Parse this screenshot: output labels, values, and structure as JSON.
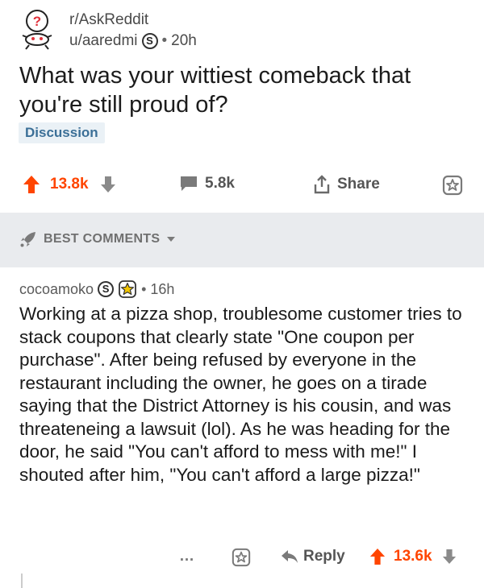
{
  "post": {
    "subreddit": "r/AskReddit",
    "author": "u/aaredmi",
    "time": "20h",
    "title": "What was your wittiest comeback that you're still proud of?",
    "flair": "Discussion"
  },
  "actions": {
    "score": "13.8k",
    "comments": "5.8k",
    "share": "Share"
  },
  "sort": {
    "label": "BEST COMMENTS"
  },
  "comment": {
    "author": "cocoamoko",
    "time": "16h",
    "body": "Working at a pizza shop, troublesome customer tries to stack coupons that clearly state \"One coupon per purchase\". After being refused by everyone in the restaurant including the owner, he goes on a tirade saying that the District Attorney is his cousin, and  was threateneing a lawsuit (lol). As he was heading for the door, he said \"You can't afford to mess with me!\" I shouted after him, \"You can't afford a large pizza!\"",
    "more": "…",
    "reply": "Reply",
    "score": "13.6k"
  },
  "meta": {
    "badge_letter": "S",
    "separator": "•"
  },
  "colors": {
    "upvote": "#ff4500",
    "flair_bg": "#eaf1f6",
    "flair_text": "#3b6f97",
    "divider_bg": "#e9ebee"
  },
  "icons": [
    "snoo-avatar-icon",
    "upvote-icon",
    "downvote-icon",
    "comment-icon",
    "share-icon",
    "save-star-icon",
    "rocket-icon",
    "chevron-down-icon",
    "gold-badge-icon",
    "reply-icon",
    "more-icon"
  ]
}
